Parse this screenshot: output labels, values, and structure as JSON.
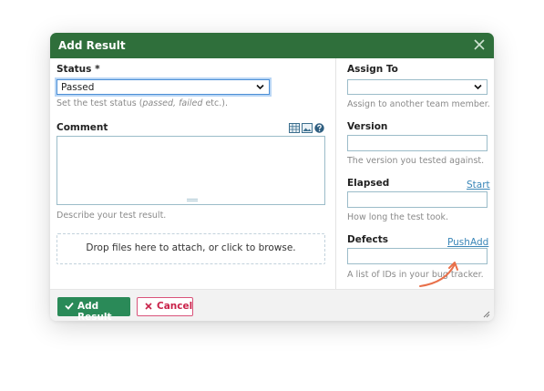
{
  "dialog": {
    "title": "Add Result",
    "close_icon": "close-icon"
  },
  "status": {
    "label": "Status",
    "required_mark": "*",
    "value": "Passed",
    "help_prefix": "Set the test status (",
    "help_em": "passed, failed",
    "help_suffix": " etc.)."
  },
  "comment": {
    "label": "Comment",
    "value": "",
    "help": "Describe your test result.",
    "toolbar_icons": [
      "table-icon",
      "image-icon",
      "help-icon"
    ]
  },
  "attachments": {
    "dropzone_text": "Drop files here to attach, or click to browse."
  },
  "assign_to": {
    "label": "Assign To",
    "value": "",
    "help": "Assign to another team member."
  },
  "version": {
    "label": "Version",
    "value": "",
    "help": "The version you tested against."
  },
  "elapsed": {
    "label": "Elapsed",
    "value": "",
    "link": "Start",
    "help": "How long the test took."
  },
  "defects": {
    "label": "Defects",
    "value": "",
    "link_push": "Push",
    "link_add": "Add",
    "help": "A list of IDs in your bug tracker."
  },
  "footer": {
    "submit_label": "Add Result",
    "cancel_label": "Cancel"
  },
  "colors": {
    "title_bar": "#2f6f3b",
    "primary_button": "#2a8a58",
    "cancel_text": "#c9234a",
    "link": "#3a86b8",
    "annotation_arrow": "#e8704a"
  }
}
